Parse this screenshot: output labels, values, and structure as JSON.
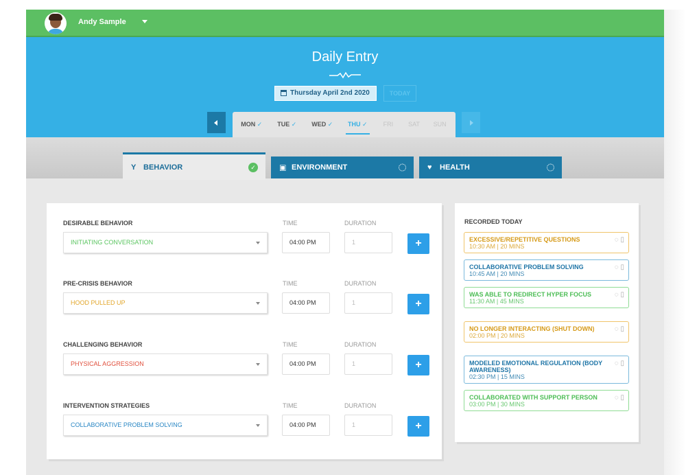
{
  "user": {
    "name": "Andy Sample",
    "avatar_icon": "user-avatar"
  },
  "header": {
    "title": "Daily Entry",
    "date": "Thursday April 2nd 2020",
    "today_label": "TODAY"
  },
  "week": {
    "days": [
      {
        "label": "MON",
        "checked": "✓",
        "state": "done"
      },
      {
        "label": "TUE",
        "checked": "✓",
        "state": "done"
      },
      {
        "label": "WED",
        "checked": "✓",
        "state": "done"
      },
      {
        "label": "THU",
        "checked": "✓",
        "state": "active"
      },
      {
        "label": "FRI",
        "checked": "",
        "state": "future"
      },
      {
        "label": "SAT",
        "checked": "",
        "state": "future"
      },
      {
        "label": "SUN",
        "checked": "",
        "state": "future"
      }
    ]
  },
  "tabs": [
    {
      "label": "BEHAVIOR",
      "icon": "behavior-icon",
      "status": "complete"
    },
    {
      "label": "ENVIRONMENT",
      "icon": "image-icon",
      "status": "pending"
    },
    {
      "label": "HEALTH",
      "icon": "heart-icon",
      "status": "pending"
    }
  ],
  "form": {
    "time_label": "TIME",
    "duration_label": "DURATION",
    "add_label": "+",
    "groups": [
      {
        "label": "DESIRABLE BEHAVIOR",
        "value": "INITIATING CONVERSATION",
        "time": "04:00 PM",
        "duration_placeholder": "1",
        "color": "#59c45f"
      },
      {
        "label": "PRE-CRISIS BEHAVIOR",
        "value": "HOOD PULLED UP",
        "time": "04:00 PM",
        "duration_placeholder": "1",
        "color": "#e2a62a"
      },
      {
        "label": "CHALLENGING BEHAVIOR",
        "value": "PHYSICAL AGGRESSION",
        "time": "04:00 PM",
        "duration_placeholder": "1",
        "color": "#e04f3c"
      },
      {
        "label": "INTERVENTION STRATEGIES",
        "value": "COLLABORATIVE PROBLEM SOLVING",
        "time": "04:00 PM",
        "duration_placeholder": "1",
        "color": "#2a87c4"
      }
    ]
  },
  "recorded": {
    "title": "RECORDED TODAY",
    "items": [
      {
        "name": "EXCESSIVE/REPETITIVE QUESTIONS",
        "meta": "10:30 AM | 20 MINS",
        "category": "pre-crisis"
      },
      {
        "name": "COLLABORATIVE PROBLEM SOLVING",
        "meta": "10:45 AM | 20 MINS",
        "category": "intervention"
      },
      {
        "name": "WAS ABLE TO REDIRECT HYPER FOCUS",
        "meta": "11:30 AM | 45 MINS",
        "category": "desirable"
      },
      {
        "name": "NO LONGER INTERACTING (SHUT DOWN)",
        "meta": "02:00 PM | 20 MINS",
        "category": "pre-crisis"
      },
      {
        "name": "MODELED EMOTIONAL REGULATION (BODY AWARENESS)",
        "meta": "02:30 PM | 15 MINS",
        "category": "intervention"
      },
      {
        "name": "COLLABORATED WITH SUPPORT PERSON",
        "meta": "03:00 PM | 30 MINS",
        "category": "desirable"
      }
    ]
  },
  "colors": {
    "topbar": "#5cbf63",
    "header": "#35b0e5",
    "tab_dark": "#1c79a6",
    "add_button": "#2d9fe8",
    "desirable": "#59c45f",
    "pre_crisis": "#e2a62a",
    "challenging": "#e04f3c",
    "intervention": "#2a87c4"
  }
}
